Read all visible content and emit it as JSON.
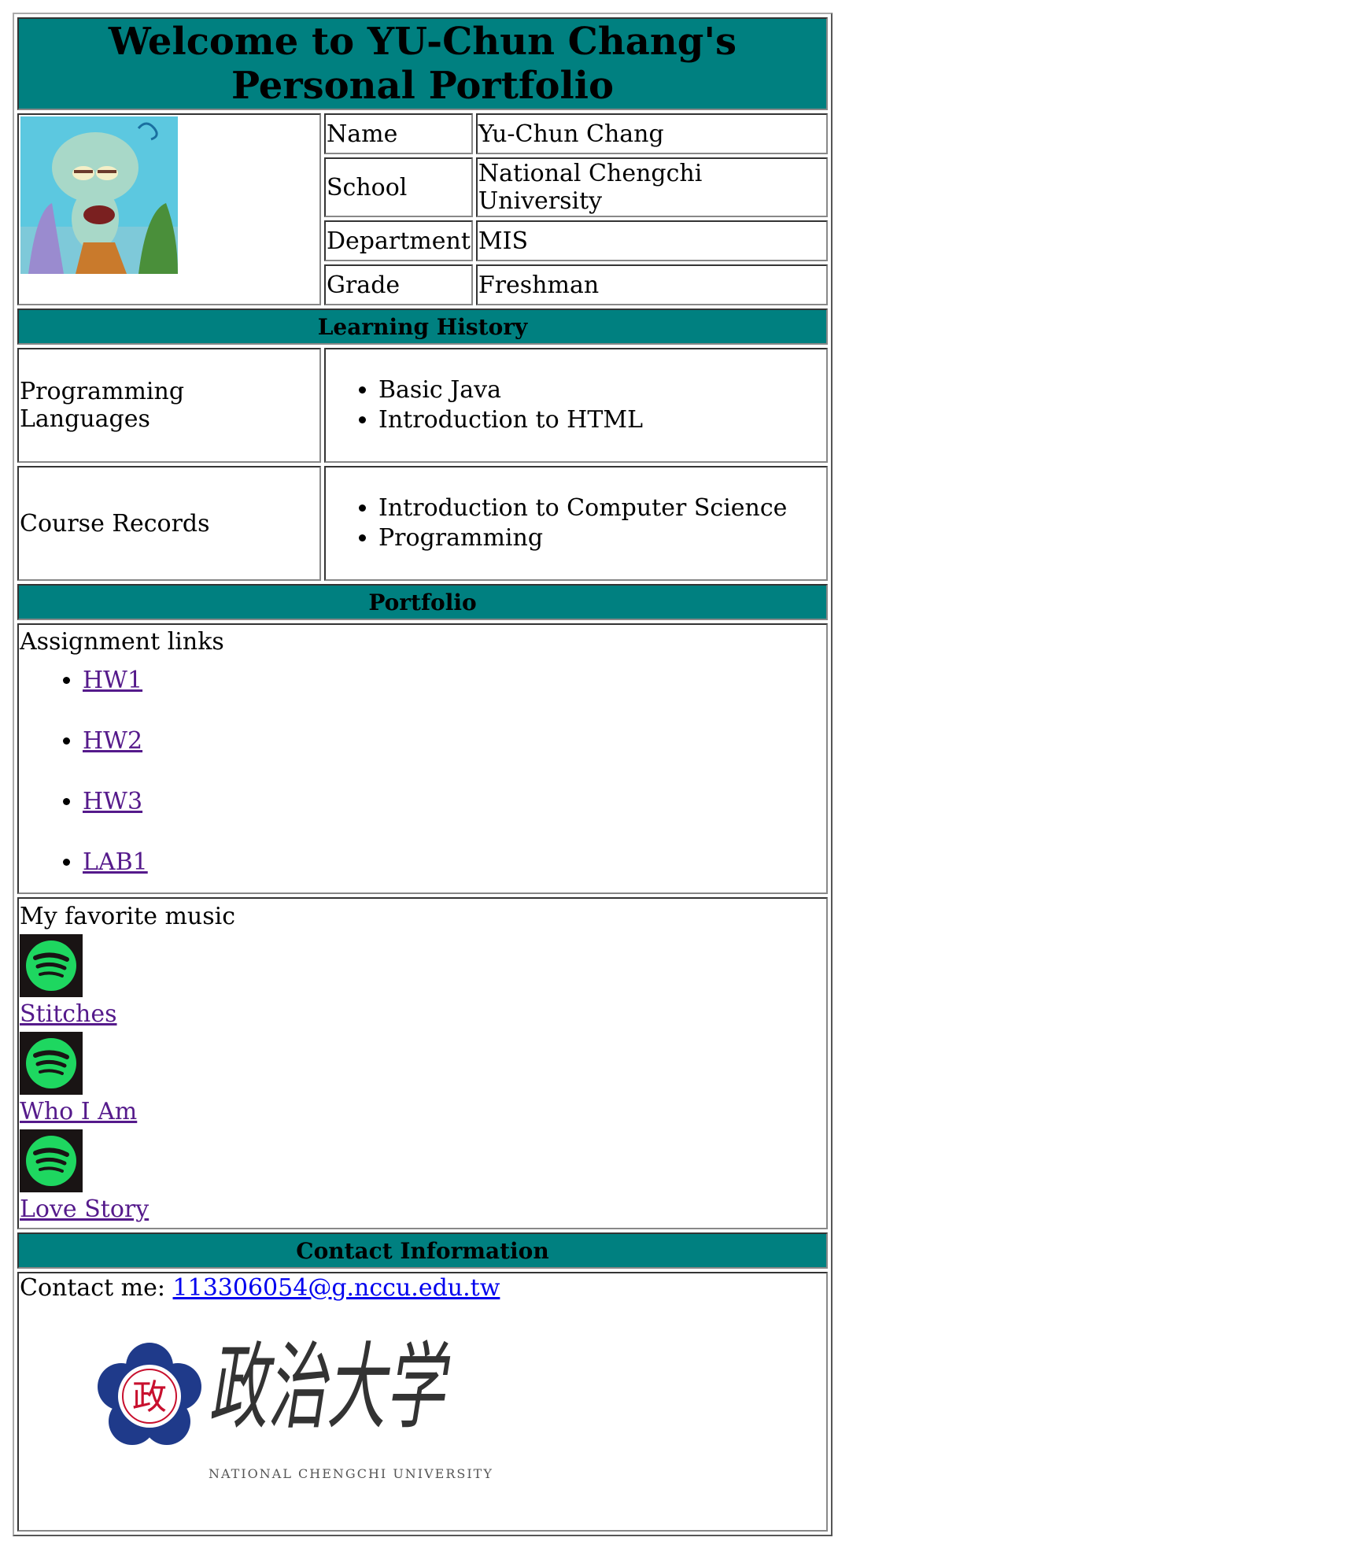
{
  "header": {
    "title": "Welcome to YU-Chun Chang's Personal Portfolio"
  },
  "profile": [
    {
      "label": "Name",
      "value": "Yu-Chun Chang"
    },
    {
      "label": "School",
      "value": "National Chengchi University"
    },
    {
      "label": "Department",
      "value": "MIS"
    },
    {
      "label": "Grade",
      "value": "Freshman"
    }
  ],
  "learning": {
    "heading": "Learning History",
    "programming_label": "Programming Languages",
    "programming_items": [
      "Basic Java",
      "Introduction to HTML"
    ],
    "courses_label": "Course Records",
    "courses_items": [
      "Introduction to Computer Science",
      "Programming"
    ]
  },
  "portfolio": {
    "heading": "Portfolio",
    "assignments_label": "Assignment links",
    "links": [
      "HW1",
      "HW2",
      "HW3",
      "LAB1"
    ],
    "music_label": "My favorite music",
    "music": [
      "Stitches",
      "Who I Am",
      "Love Story"
    ]
  },
  "contact": {
    "heading": "Contact Information",
    "prefix": "Contact me: ",
    "email": "113306054@g.nccu.edu.tw",
    "logo_text": "NATIONAL CHENGCHI UNIVERSITY",
    "logo_calligraphy": "政治大学",
    "logo_seal": "政"
  },
  "colors": {
    "header_bg": "#008080",
    "spotify_green": "#1ed760",
    "link_visited": "#551a8b",
    "link": "#0000ee",
    "logo_blue": "#1f3a8a"
  }
}
